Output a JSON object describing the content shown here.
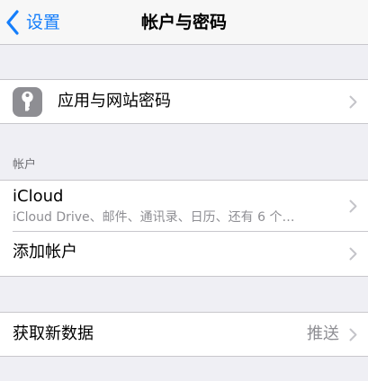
{
  "navbar": {
    "back_label": "设置",
    "title": "帐户与密码"
  },
  "passwords_row": {
    "label": "应用与网站密码",
    "icon": "key-icon"
  },
  "accounts_section": {
    "header": "帐户",
    "icloud": {
      "title": "iCloud",
      "subtitle": "iCloud Drive、邮件、通讯录、日历、还有 6 个…"
    },
    "add_account_label": "添加帐户"
  },
  "fetch_row": {
    "label": "获取新数据",
    "value": "推送"
  },
  "colors": {
    "accent": "#157efb",
    "background": "#efeff4",
    "secondary_text": "#8e8e93",
    "separator": "#c8c7cc"
  }
}
